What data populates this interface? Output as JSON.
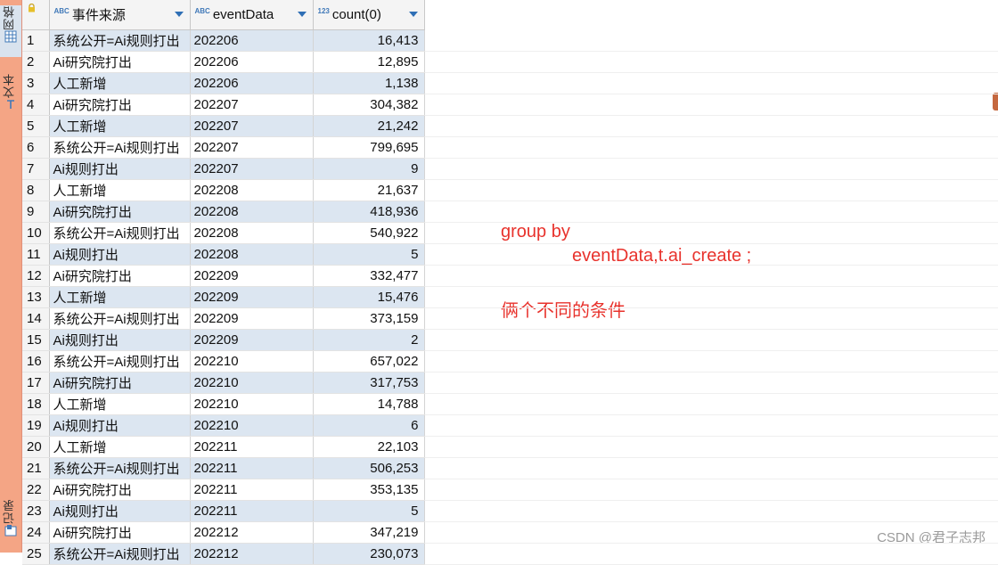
{
  "sidebar": {
    "tab_grid": "网格",
    "tab_text": "文本",
    "tab_record": "记录"
  },
  "columns": [
    {
      "type": "ABC",
      "name": "事件来源"
    },
    {
      "type": "ABC",
      "name": "eventData"
    },
    {
      "type": "123",
      "name": "count(0)"
    }
  ],
  "rows": [
    {
      "n": "1",
      "source": "系统公开=Ai规则打出",
      "event": "202206",
      "count": "16,413"
    },
    {
      "n": "2",
      "source": "Ai研究院打出",
      "event": "202206",
      "count": "12,895"
    },
    {
      "n": "3",
      "source": "人工新增",
      "event": "202206",
      "count": "1,138"
    },
    {
      "n": "4",
      "source": "Ai研究院打出",
      "event": "202207",
      "count": "304,382"
    },
    {
      "n": "5",
      "source": "人工新增",
      "event": "202207",
      "count": "21,242"
    },
    {
      "n": "6",
      "source": "系统公开=Ai规则打出",
      "event": "202207",
      "count": "799,695"
    },
    {
      "n": "7",
      "source": "Ai规则打出",
      "event": "202207",
      "count": "9"
    },
    {
      "n": "8",
      "source": "人工新增",
      "event": "202208",
      "count": "21,637"
    },
    {
      "n": "9",
      "source": "Ai研究院打出",
      "event": "202208",
      "count": "418,936"
    },
    {
      "n": "10",
      "source": "系统公开=Ai规则打出",
      "event": "202208",
      "count": "540,922"
    },
    {
      "n": "11",
      "source": "Ai规则打出",
      "event": "202208",
      "count": "5"
    },
    {
      "n": "12",
      "source": "Ai研究院打出",
      "event": "202209",
      "count": "332,477"
    },
    {
      "n": "13",
      "source": "人工新增",
      "event": "202209",
      "count": "15,476"
    },
    {
      "n": "14",
      "source": "系统公开=Ai规则打出",
      "event": "202209",
      "count": "373,159"
    },
    {
      "n": "15",
      "source": "Ai规则打出",
      "event": "202209",
      "count": "2"
    },
    {
      "n": "16",
      "source": "系统公开=Ai规则打出",
      "event": "202210",
      "count": "657,022"
    },
    {
      "n": "17",
      "source": "Ai研究院打出",
      "event": "202210",
      "count": "317,753"
    },
    {
      "n": "18",
      "source": "人工新增",
      "event": "202210",
      "count": "14,788"
    },
    {
      "n": "19",
      "source": "Ai规则打出",
      "event": "202210",
      "count": "6"
    },
    {
      "n": "20",
      "source": "人工新增",
      "event": "202211",
      "count": "22,103"
    },
    {
      "n": "21",
      "source": "系统公开=Ai规则打出",
      "event": "202211",
      "count": "506,253"
    },
    {
      "n": "22",
      "source": "Ai研究院打出",
      "event": "202211",
      "count": "353,135"
    },
    {
      "n": "23",
      "source": "Ai规则打出",
      "event": "202211",
      "count": "5"
    },
    {
      "n": "24",
      "source": "Ai研究院打出",
      "event": "202212",
      "count": "347,219"
    },
    {
      "n": "25",
      "source": "系统公开=Ai规则打出",
      "event": "202212",
      "count": "230,073"
    }
  ],
  "annotation": {
    "line1": "group by",
    "line2": "eventData,t.ai_create ;",
    "line3": "俩个不同的条件"
  },
  "watermark": "CSDN @君子志邦"
}
